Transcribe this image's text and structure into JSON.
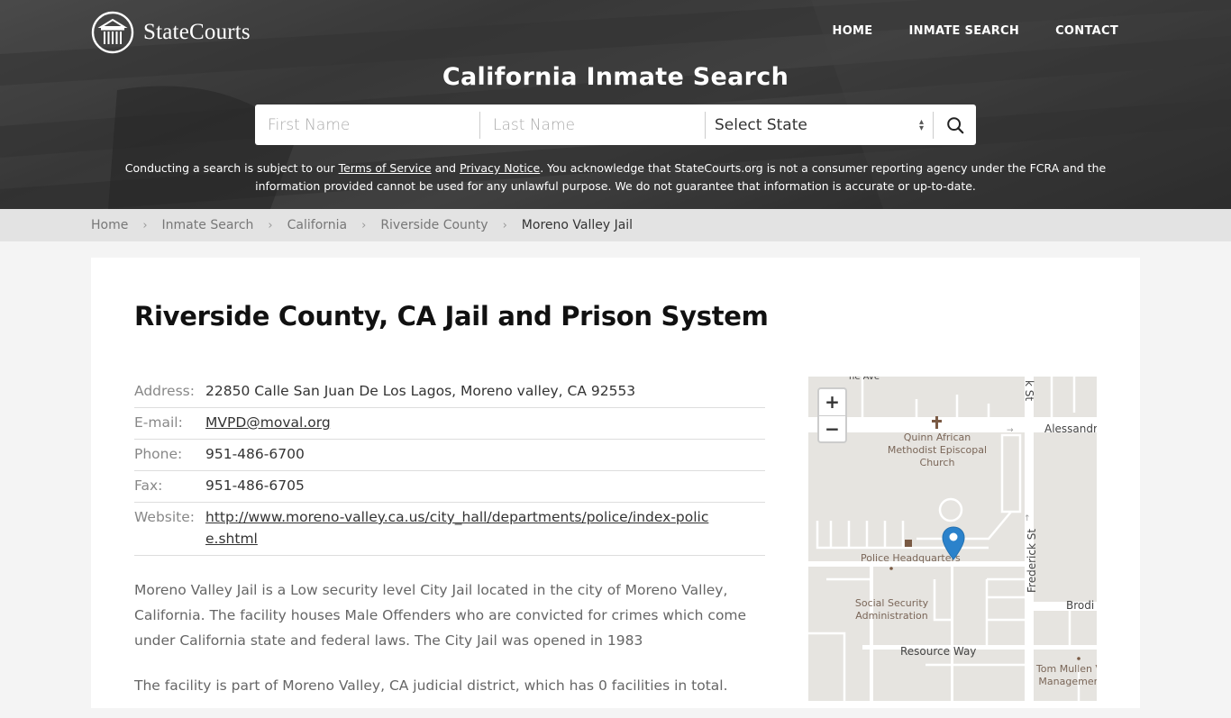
{
  "header": {
    "logo_text": "StateCourts",
    "nav": [
      {
        "label": "HOME"
      },
      {
        "label": "INMATE SEARCH"
      },
      {
        "label": "CONTACT"
      }
    ],
    "hero_title": "California Inmate Search",
    "search": {
      "first_name_placeholder": "First Name",
      "last_name_placeholder": "Last Name",
      "state_selected": "Select State"
    },
    "disclaimer": {
      "prefix": "Conducting a search is subject to our ",
      "terms_link": "Terms of Service",
      "and": " and ",
      "privacy_link": "Privacy Notice",
      "suffix": ". You acknowledge that StateCourts.org is not a consumer reporting agency under the FCRA and the information provided cannot be used for any unlawful purpose. We do not guarantee that information is accurate or up-to-date."
    }
  },
  "breadcrumb": [
    {
      "label": "Home"
    },
    {
      "label": "Inmate Search"
    },
    {
      "label": "California"
    },
    {
      "label": "Riverside County"
    },
    {
      "label": "Moreno Valley Jail"
    }
  ],
  "main": {
    "title": "Riverside County, CA Jail and Prison System",
    "info": {
      "address_label": "Address:",
      "address": "22850 Calle San Juan De Los Lagos, Moreno valley, CA 92553",
      "email_label": "E-mail:",
      "email": "MVPD@moval.org",
      "phone_label": "Phone:",
      "phone": "951-486-6700",
      "fax_label": "Fax:",
      "fax": "951-486-6705",
      "website_label": "Website:",
      "website": "http://www.moreno-valley.ca.us/city_hall/departments/police/index-police.shtml"
    },
    "description": [
      "Moreno Valley Jail is a Low security level City Jail located in the city of Moreno Valley, California. The facility houses Male Offenders who are convicted for crimes which come under California state and federal laws. The City Jail was opened in 1983",
      "The facility is part of Moreno Valley, CA judicial district, which has 0 facilities in total."
    ]
  },
  "map": {
    "zoom_in": "+",
    "zoom_out": "−",
    "labels": {
      "top_ave": "he Ave",
      "k_st": "k St",
      "alessandro": "Alessandro",
      "church": "Quinn African Methodist Episcopal Church",
      "police": "Police Headquarters",
      "frederick": "Frederick St",
      "ssa": "Social Security Administration",
      "brodi": "Brodi",
      "resource": "Resource Way",
      "tom": "Tom Mullen V Managemen"
    },
    "pin_color": "#2b82cb"
  }
}
